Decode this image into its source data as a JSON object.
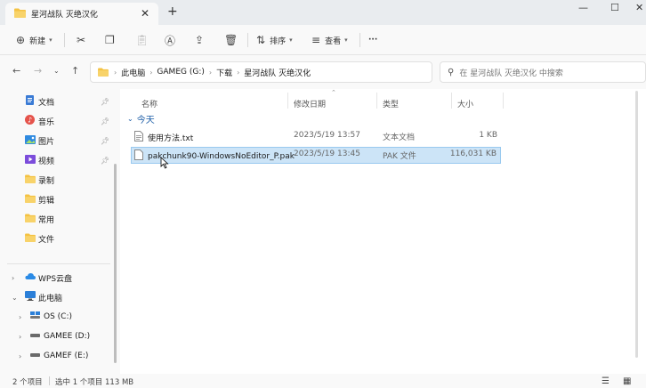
{
  "tab": {
    "title": "星河战队 灭绝汉化",
    "close": "✕",
    "new_tab": "+"
  },
  "window": {
    "minimize": "—",
    "maximize": "☐",
    "close": "✕"
  },
  "ribbon": {
    "new_label": "新建",
    "sort_label": "排序",
    "view_label": "查看",
    "more_label": "···"
  },
  "breadcrumbs": [
    "此电脑",
    "GAMEG (G:)",
    "下载",
    "星河战队 灭绝汉化"
  ],
  "search": {
    "placeholder": "在 星河战队 灭绝汉化 中搜索"
  },
  "sidebar": {
    "quick": [
      {
        "label": "文档",
        "icon": "document-icon",
        "pinned": true
      },
      {
        "label": "音乐",
        "icon": "music-icon",
        "pinned": true
      },
      {
        "label": "图片",
        "icon": "picture-icon",
        "pinned": true
      },
      {
        "label": "视频",
        "icon": "video-icon",
        "pinned": true
      },
      {
        "label": "录制",
        "icon": "folder-icon",
        "pinned": false
      },
      {
        "label": "剪辑",
        "icon": "folder-icon",
        "pinned": false
      },
      {
        "label": "常用",
        "icon": "folder-icon",
        "pinned": false
      },
      {
        "label": "文件",
        "icon": "folder-icon",
        "pinned": false
      }
    ],
    "tree": [
      {
        "label": "WPS云盘",
        "icon": "cloud-icon"
      },
      {
        "label": "此电脑",
        "icon": "computer-icon"
      },
      {
        "label": "OS (C:)",
        "icon": "drive-icon"
      },
      {
        "label": "GAMEE (D:)",
        "icon": "drive-icon"
      },
      {
        "label": "GAMEF (E:)",
        "icon": "drive-icon"
      }
    ]
  },
  "columns": {
    "name": "名称",
    "modified": "修改日期",
    "type": "类型",
    "size": "大小"
  },
  "group": {
    "label": "今天"
  },
  "files": [
    {
      "name": "使用方法.txt",
      "modified": "2023/5/19 13:57",
      "type": "文本文档",
      "size": "1 KB",
      "selected": false
    },
    {
      "name": "pakchunk90-WindowsNoEditor_P.pak",
      "modified": "2023/5/19 13:45",
      "type": "PAK 文件",
      "size": "116,031 KB",
      "selected": true
    }
  ],
  "status": {
    "count": "2 个项目",
    "selection": "选中 1 个项目  113 MB"
  },
  "colors": {
    "accent": "#0067c0",
    "selection": "#cce4f7",
    "folder": "#f4c243"
  }
}
